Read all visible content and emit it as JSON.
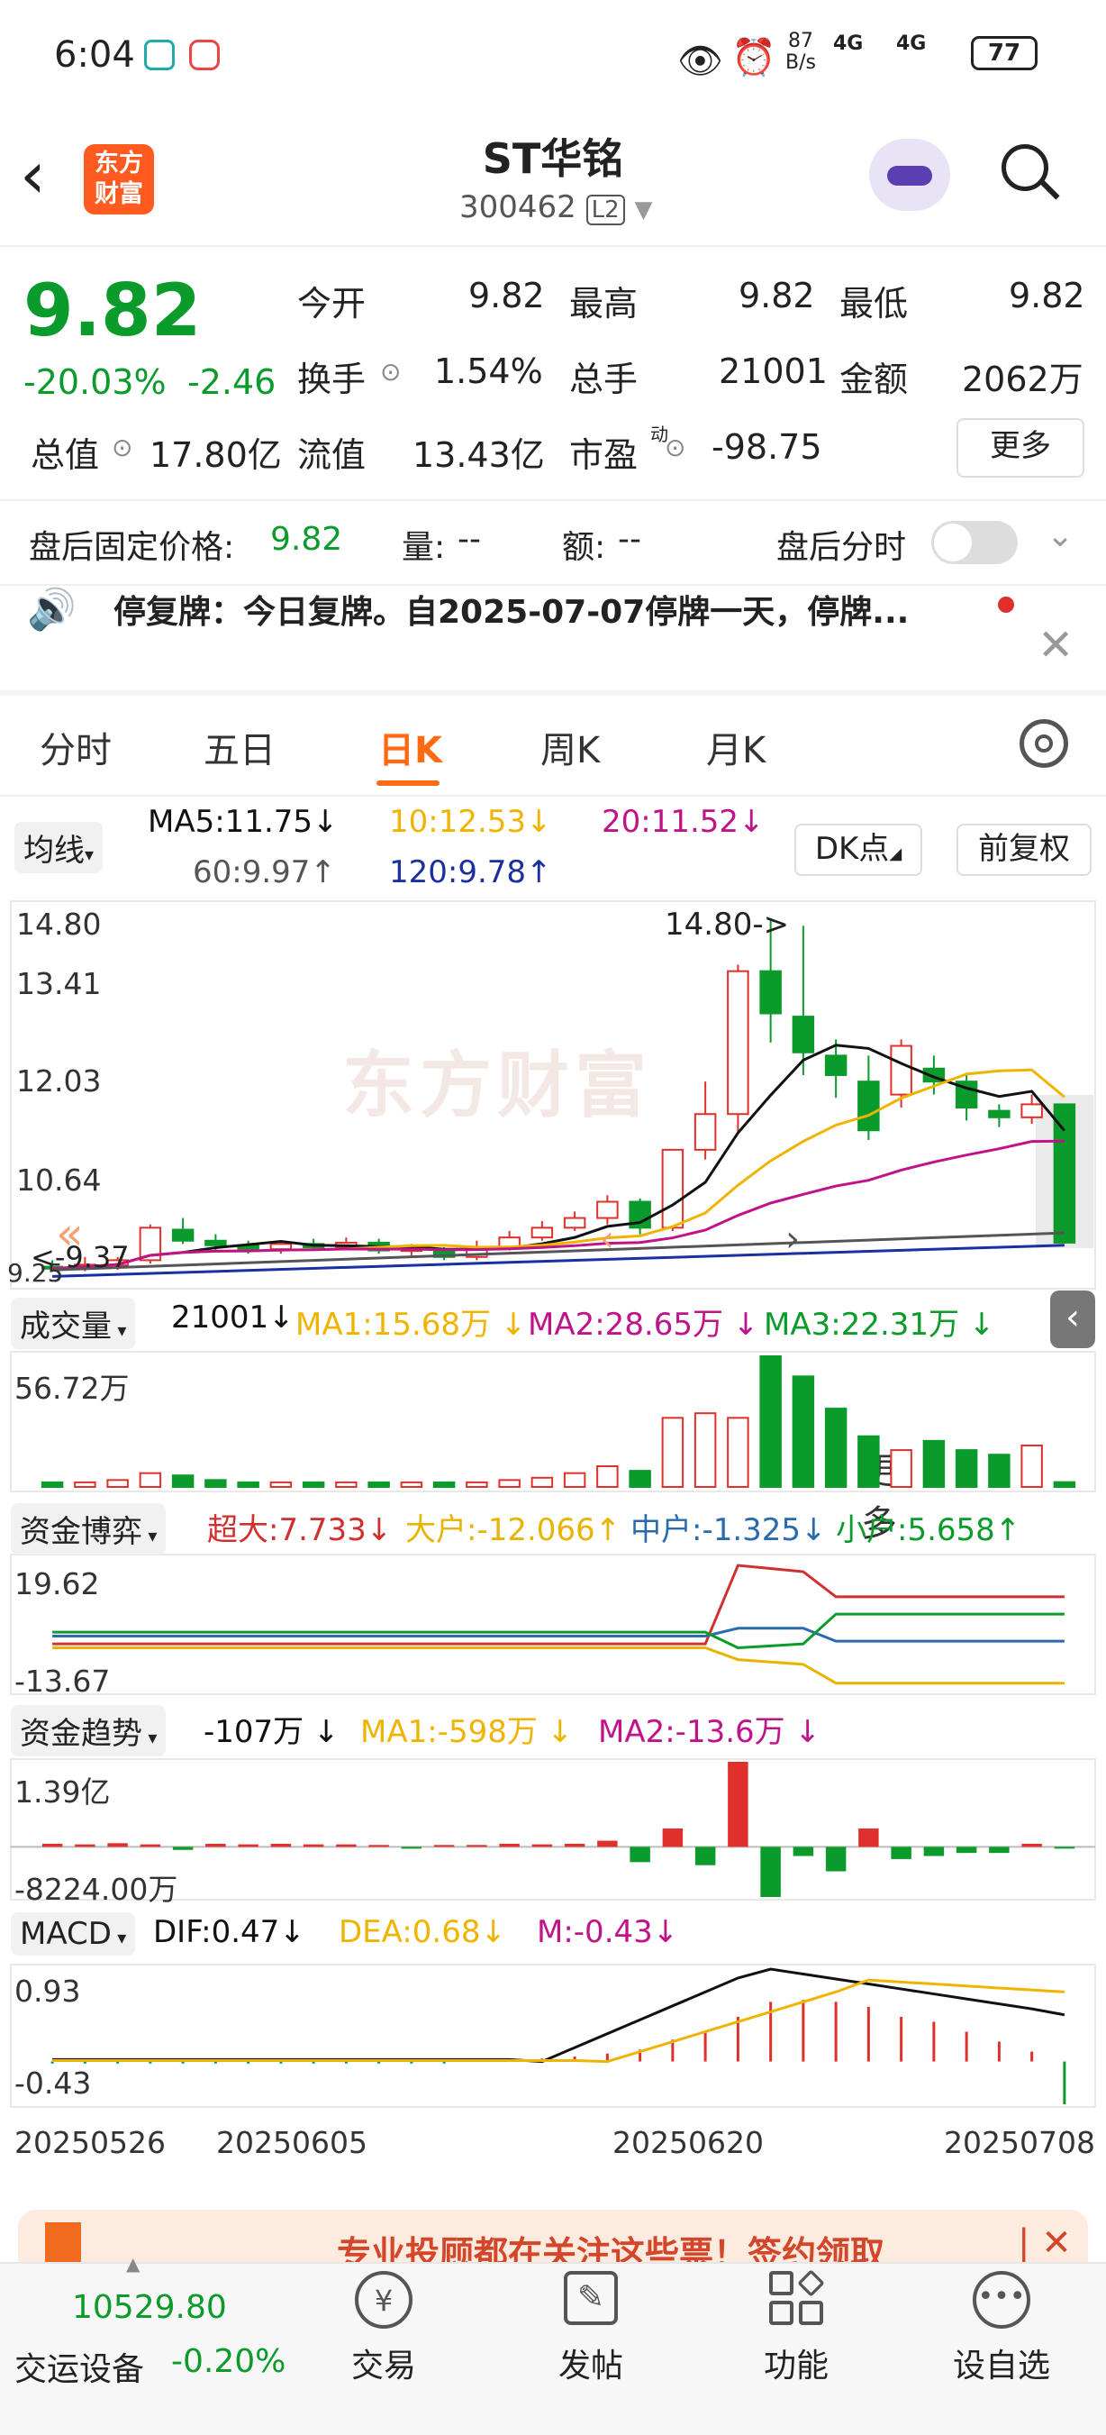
{
  "status_bar": {
    "time": "6:04",
    "net_speed_value": "87",
    "net_speed_unit": "B/s",
    "signal1": "4G",
    "signal2": "4G",
    "battery": "77"
  },
  "header": {
    "title": "ST华铭",
    "code": "300462",
    "level_badge": "L2",
    "logo_line1": "东方",
    "logo_line2": "财富"
  },
  "quote": {
    "price": "9.82",
    "change_pct": "-20.03%",
    "change_abs": "-2.46",
    "open_label": "今开",
    "open": "9.82",
    "high_label": "最高",
    "high": "9.82",
    "low_label": "最低",
    "low": "9.82",
    "turnover_label": "换手",
    "turnover": "1.54%",
    "volume_label": "总手",
    "volume": "21001",
    "amount_label": "金额",
    "amount": "2062万",
    "mktcap_label": "总值",
    "mktcap": "17.80亿",
    "float_label": "流值",
    "float_cap": "13.43亿",
    "pe_label": "市盈",
    "pe_sup": "动",
    "pe": "-98.75",
    "more_button": "更多"
  },
  "after_hours": {
    "label": "盘后固定价格:",
    "price": "9.82",
    "vol_label": "量:",
    "vol": "--",
    "amt_label": "额:",
    "amt": "--",
    "toggle_label": "盘后分时"
  },
  "notice": {
    "text": "停复牌：今日复牌。自2025-07-07停牌一天，停牌..."
  },
  "tabs": [
    "分时",
    "五日",
    "日K",
    "周K",
    "月K",
    "更多"
  ],
  "active_tab": "日K",
  "ma_bar": {
    "selector": "均线",
    "ma5": "MA5:11.75",
    "ma10": "10:12.53",
    "ma20": "20:11.52",
    "ma60": "60:9.97",
    "ma120": "120:9.78",
    "dk_button": "DK点",
    "adjust_button": "前复权"
  },
  "kline": {
    "y_labels": [
      "14.80",
      "13.41",
      "12.03",
      "10.64",
      "9.25"
    ],
    "high_marker": "14.80->",
    "low_marker": "<-9.37",
    "watermark": "东方财富"
  },
  "volume_panel": {
    "selector": "成交量",
    "value": "21001",
    "ma1": "MA1:15.68万",
    "ma2": "MA2:28.65万",
    "ma3": "MA3:22.31万",
    "y_label": "56.72万"
  },
  "fund_game": {
    "selector": "资金博弈",
    "super": "超大:7.733",
    "large": "大户:-12.066",
    "medium": "中户:-1.325",
    "small": "小户:5.658",
    "y_top": "19.62",
    "y_bottom": "-13.67"
  },
  "fund_trend": {
    "selector": "资金趋势",
    "value": "-107万",
    "ma1": "MA1:-598万",
    "ma2": "MA2:-13.6万",
    "y_top": "1.39亿",
    "y_bottom": "-8224.00万"
  },
  "macd": {
    "selector": "MACD",
    "dif": "DIF:0.47",
    "dea": "DEA:0.68",
    "m": "M:-0.43",
    "y_top": "0.93",
    "y_bottom": "-0.43"
  },
  "dates": [
    "20250526",
    "20250605",
    "20250620",
    "20250708"
  ],
  "promo": {
    "text": "专业投顾都在关注这些票！签约领取"
  },
  "bottom_nav": {
    "index_value": "10529.80",
    "index_name": "交运设备",
    "index_change": "-0.20%",
    "trade": "交易",
    "post": "发帖",
    "function": "功能",
    "watchlist": "设自选"
  },
  "colors": {
    "up": "#e0302b",
    "down": "#0a9b2b",
    "accent": "#ff6a13",
    "ma5": "#111111",
    "ma10": "#f0b400",
    "ma20": "#c0138a",
    "ma60": "#555555",
    "ma120": "#1a2fa0"
  },
  "chart_data": {
    "type": "candlestick",
    "x": [
      "d1",
      "d2",
      "d3",
      "d4",
      "d5",
      "d6",
      "d7",
      "d8",
      "d9",
      "d10",
      "d11",
      "d12",
      "d13",
      "d14",
      "d15",
      "d16",
      "d17",
      "d18",
      "d19",
      "d20",
      "d21",
      "d22",
      "d23",
      "d24",
      "d25",
      "d26",
      "d27",
      "d28",
      "d29",
      "d30",
      "d31",
      "d32"
    ],
    "ohlc": [
      [
        9.45,
        9.42,
        9.55,
        9.4
      ],
      [
        9.42,
        9.48,
        9.6,
        9.38
      ],
      [
        9.47,
        9.55,
        9.6,
        9.4
      ],
      [
        9.55,
        10.05,
        10.1,
        9.5
      ],
      [
        10.02,
        9.85,
        10.2,
        9.8
      ],
      [
        9.85,
        9.78,
        9.95,
        9.7
      ],
      [
        9.78,
        9.72,
        9.85,
        9.65
      ],
      [
        9.72,
        9.8,
        9.85,
        9.65
      ],
      [
        9.8,
        9.75,
        9.88,
        9.7
      ],
      [
        9.75,
        9.82,
        9.9,
        9.7
      ],
      [
        9.82,
        9.7,
        9.88,
        9.65
      ],
      [
        9.7,
        9.72,
        9.8,
        9.62
      ],
      [
        9.7,
        9.6,
        9.75,
        9.55
      ],
      [
        9.6,
        9.75,
        9.85,
        9.55
      ],
      [
        9.75,
        9.9,
        10.0,
        9.7
      ],
      [
        9.9,
        10.05,
        10.15,
        9.85
      ],
      [
        10.05,
        10.2,
        10.3,
        10.0
      ],
      [
        10.2,
        10.45,
        10.55,
        10.1
      ],
      [
        10.45,
        10.05,
        10.5,
        9.95
      ],
      [
        10.05,
        11.25,
        11.25,
        10.0
      ],
      [
        11.25,
        11.8,
        12.3,
        11.1
      ],
      [
        11.8,
        14.0,
        14.1,
        11.5
      ],
      [
        14.0,
        13.35,
        14.8,
        12.9
      ],
      [
        13.3,
        12.75,
        14.7,
        12.4
      ],
      [
        12.7,
        12.4,
        12.95,
        12.05
      ],
      [
        12.3,
        11.55,
        12.7,
        11.4
      ],
      [
        12.1,
        12.85,
        12.95,
        11.9
      ],
      [
        12.5,
        12.3,
        12.7,
        12.1
      ],
      [
        12.3,
        11.9,
        12.4,
        11.7
      ],
      [
        11.85,
        11.75,
        11.95,
        11.6
      ],
      [
        11.75,
        11.95,
        12.1,
        11.65
      ],
      [
        11.95,
        9.82,
        11.95,
        9.82
      ]
    ],
    "ylim": [
      9.25,
      14.8
    ],
    "volume": [
      2,
      2,
      3,
      6,
      5,
      3,
      2,
      2,
      2,
      2,
      2,
      2,
      2,
      2,
      3,
      4,
      6,
      9,
      7,
      30,
      32,
      30,
      56.72,
      48,
      34,
      22,
      16,
      20,
      16,
      14,
      18,
      2.1
    ],
    "macd_hist": [
      -0.02,
      -0.02,
      -0.02,
      -0.02,
      -0.02,
      -0.02,
      -0.02,
      -0.02,
      -0.02,
      -0.02,
      -0.02,
      -0.02,
      -0.02,
      0.01,
      0.02,
      0.03,
      0.05,
      0.08,
      0.12,
      0.22,
      0.3,
      0.45,
      0.6,
      0.62,
      0.6,
      0.55,
      0.45,
      0.4,
      0.3,
      0.2,
      0.1,
      -0.43
    ],
    "fund_trend_bars": [
      0.05,
      0.04,
      0.06,
      0.04,
      -0.05,
      0.05,
      0.04,
      0.05,
      0.04,
      0.04,
      0.03,
      -0.03,
      0.03,
      0.03,
      0.05,
      0.04,
      0.05,
      0.1,
      -0.25,
      0.3,
      -0.3,
      1.39,
      -0.82,
      -0.15,
      -0.4,
      0.3,
      -0.2,
      -0.15,
      -0.1,
      -0.1,
      0.05,
      -0.02
    ]
  }
}
